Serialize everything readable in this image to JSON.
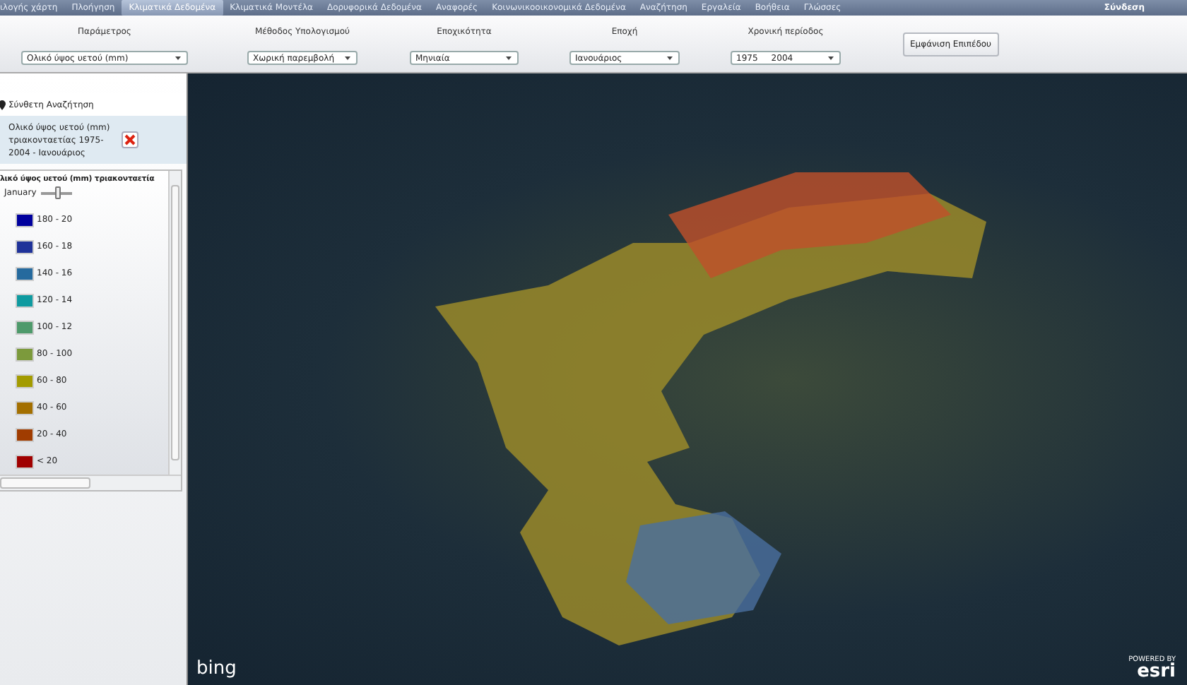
{
  "menu": {
    "items": [
      {
        "label": "ιλογής χάρτη",
        "selected": false
      },
      {
        "label": "Πλοήγηση",
        "selected": false
      },
      {
        "label": "Κλιματικά Δεδομένα",
        "selected": true
      },
      {
        "label": "Κλιματικά Μοντέλα",
        "selected": false
      },
      {
        "label": "Δορυφορικά Δεδομένα",
        "selected": false
      },
      {
        "label": "Αναφορές",
        "selected": false
      },
      {
        "label": "Κοινωνικοοικονομικά Δεδομένα",
        "selected": false
      },
      {
        "label": "Αναζήτηση",
        "selected": false
      },
      {
        "label": "Εργαλεία",
        "selected": false
      },
      {
        "label": "Βοήθεια",
        "selected": false
      },
      {
        "label": "Γλώσσες",
        "selected": false
      }
    ],
    "login": "Σύνδεση"
  },
  "toolbar": {
    "fields": [
      {
        "label": "Παράμετρος",
        "value": "Ολικό ύψος υετού (mm)"
      },
      {
        "label": "Μέθοδος Υπολογισμού",
        "value": "Χωρική παρεμβολή"
      },
      {
        "label": "Εποχικότητα",
        "value": "Μηνιαία"
      },
      {
        "label": "Εποχή",
        "value": "Ιανουάριος"
      },
      {
        "label": "Χρονική περίοδος",
        "value": "1975     2004"
      }
    ],
    "button": "Εμφάνιση Επιπέδου"
  },
  "sidebar": {
    "header": "Σύνθετη Αναζήτηση",
    "layer": "Ολικό ύψος υετού (mm) τριακονταετίας 1975-2004 - Ιανουάριος",
    "legend": {
      "title": "λικό ύψος υετού (mm) τριακονταετία",
      "slider": {
        "label": "January",
        "level": 0.55
      },
      "items": [
        {
          "label": "180 - 20",
          "color": "#00009e"
        },
        {
          "label": "160 - 18",
          "color": "#1f3299"
        },
        {
          "label": "140 - 16",
          "color": "#256a9e"
        },
        {
          "label": "120 - 14",
          "color": "#0e9aa0"
        },
        {
          "label": "100 - 12",
          "color": "#4e9a6b"
        },
        {
          "label": "80 - 100",
          "color": "#7c9a3c"
        },
        {
          "label": "60 - 80",
          "color": "#a39b00"
        },
        {
          "label": "40 - 60",
          "color": "#a36f00"
        },
        {
          "label": "20 - 40",
          "color": "#a03c00"
        },
        {
          "label": "< 20",
          "color": "#a00000"
        }
      ]
    }
  },
  "map": {
    "provider_logo": "bing",
    "credit_prefix": "POWERED BY",
    "credit_logo": "esri"
  }
}
